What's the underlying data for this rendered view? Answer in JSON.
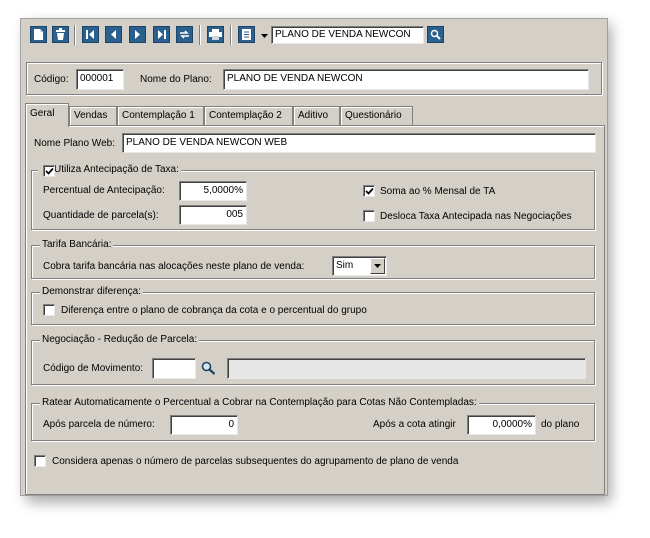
{
  "toolbar": {
    "buttons": [
      "new-icon",
      "delete-icon",
      "first-icon",
      "prev-icon",
      "next-icon",
      "last-icon",
      "refresh-icon",
      "print-icon",
      "list-icon"
    ],
    "search_value": "PLANO DE VENDA NEWCON"
  },
  "header": {
    "codigo_label": "Código:",
    "codigo_value": "000001",
    "nome_label": "Nome do Plano:",
    "nome_value": "PLANO DE VENDA NEWCON"
  },
  "tabs": [
    "Geral",
    "Vendas",
    "Contemplação 1",
    "Contemplação 2",
    "Aditivo",
    "Questionário"
  ],
  "geral": {
    "nome_web_label": "Nome Plano Web:",
    "nome_web_value": "PLANO DE VENDA NEWCON WEB",
    "antecipacao": {
      "title": "Utiliza Antecipação de Taxa:",
      "checked": true,
      "percentual_label": "Percentual de Antecipação:",
      "percentual_value": "5,0000%",
      "quantidade_label": "Quantidade de parcela(s):",
      "quantidade_value": "005",
      "soma_label": "Soma ao % Mensal de TA",
      "soma_checked": true,
      "desloca_label": "Desloca Taxa Antecipada nas Negociações",
      "desloca_checked": false
    },
    "tarifa": {
      "title": "Tarifa Bancária:",
      "cobra_label": "Cobra tarifa bancária nas alocações neste plano de venda:",
      "cobra_value": "Sim"
    },
    "diferenca": {
      "title": "Demonstrar diferença:",
      "label": "Diferença entre o plano de cobrança da cota e o percentual do grupo",
      "checked": false
    },
    "negociacao": {
      "title": "Negociação - Redução de Parcela:",
      "codigo_label": "Código de Movimento:",
      "codigo_value": "",
      "descricao_value": ""
    },
    "ratear": {
      "title": "Ratear Automaticamente o Percentual a Cobrar na Contemplação para Cotas Não Contempladas:",
      "apos_parcela_label": "Após parcela de número:",
      "apos_parcela_value": "0",
      "apos_cota_label": "Após a cota atingir",
      "apos_cota_value": "0,0000%",
      "do_plano_label": "do plano"
    },
    "considera": {
      "label": "Considera apenas o número de parcelas subsequentes do agrupamento de plano de venda",
      "checked": false
    }
  }
}
